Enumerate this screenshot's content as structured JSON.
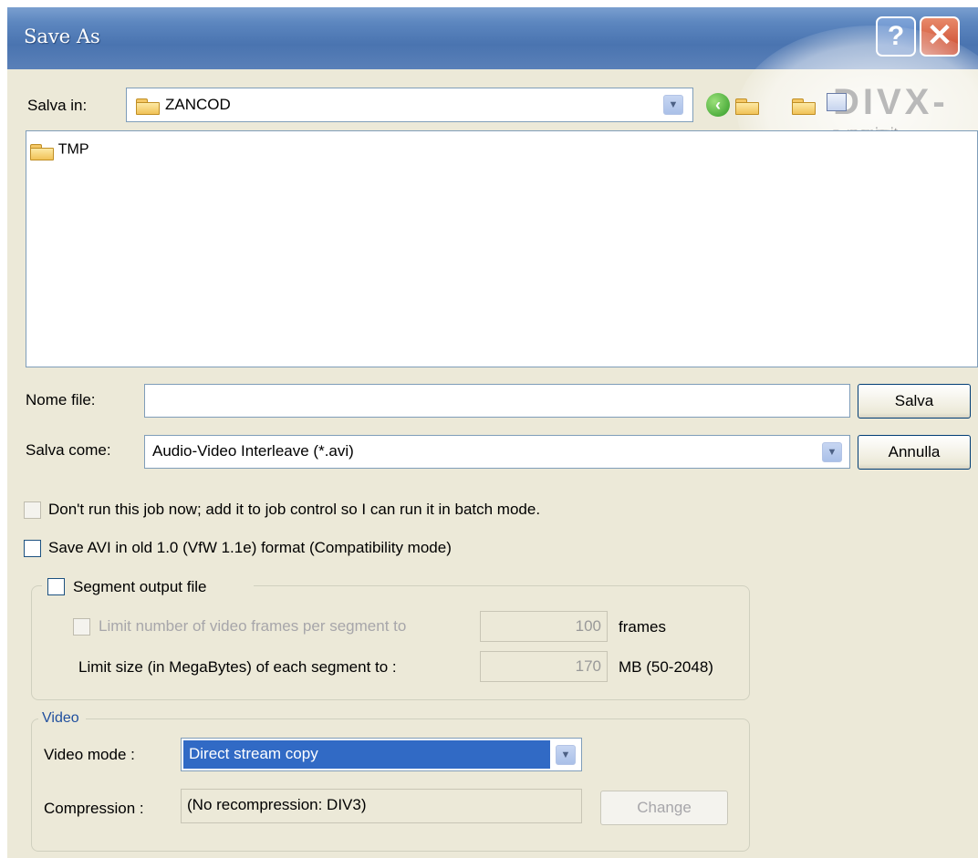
{
  "window": {
    "title": "Save As"
  },
  "titlebar": {
    "help_glyph": "?",
    "close_glyph": "✕"
  },
  "watermark": {
    "text": "DIVX-VID",
    "sub": "mania.it"
  },
  "location": {
    "label": "Salva in:",
    "value": "ZANCOD",
    "dropdown_glyph": "▼",
    "toolbar_icons": [
      "back-icon",
      "up-folder-icon",
      "new-folder-icon",
      "views-menu-icon"
    ]
  },
  "file_list": {
    "items": [
      {
        "name": "TMP",
        "icon": "folder-icon"
      }
    ]
  },
  "filename": {
    "label": "Nome file:",
    "value": ""
  },
  "filetype": {
    "label": "Salva come:",
    "value": "Audio-Video Interleave (*.avi)",
    "dropdown_glyph": "▼"
  },
  "buttons": {
    "save": "Salva",
    "cancel": "Annulla",
    "change": "Change"
  },
  "options": {
    "batch": "Don't run this job now; add it to job control so I can run it in batch mode.",
    "old_avi": "Save AVI in old 1.0 (VfW 1.1e) format (Compatibility mode)"
  },
  "segment": {
    "checkbox_label": "Segment output file",
    "frames_label": "Limit number of video frames per segment to",
    "frames_value": "100",
    "frames_unit": "frames",
    "size_label": "Limit size (in MegaBytes) of each segment to :",
    "size_value": "170",
    "size_unit": "MB (50-2048)"
  },
  "video": {
    "group_label": "Video",
    "mode_label": "Video mode :",
    "mode_value": "Direct stream copy",
    "mode_dropdown_glyph": "▼",
    "compression_label": "Compression :",
    "compression_value": "(No recompression: DIV3)"
  },
  "colors": {
    "title_blue": "#4a74b0",
    "group_label_blue": "#1f4e9e",
    "selection": "#316ac5",
    "dialog_bg": "#ece9d8"
  }
}
